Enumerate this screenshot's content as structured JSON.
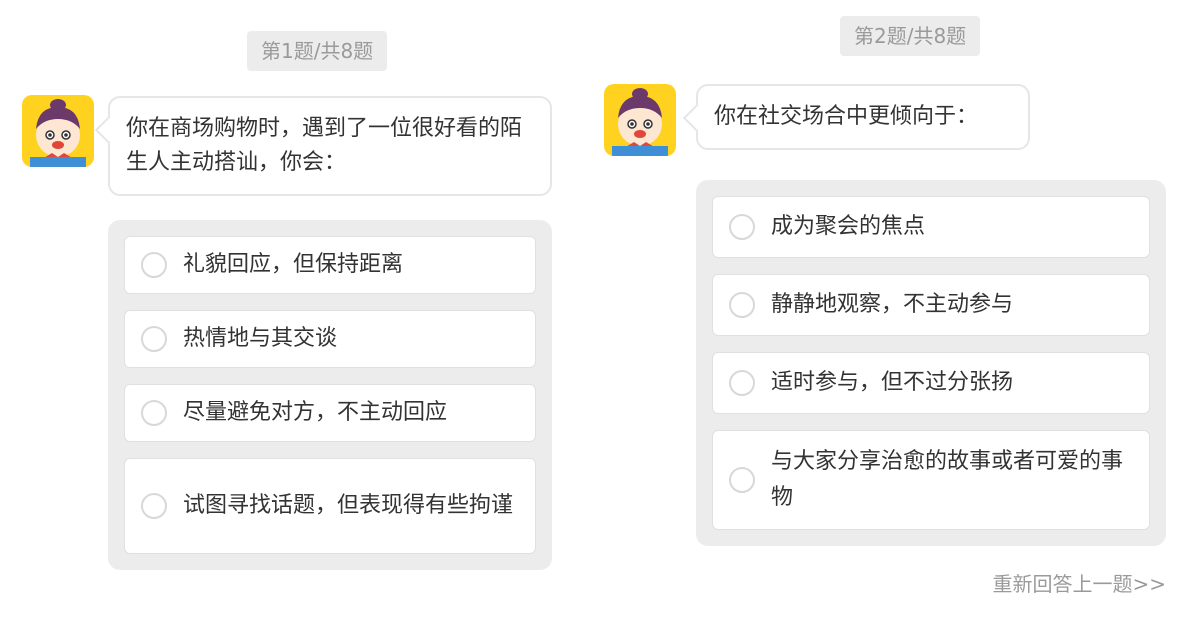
{
  "questions": [
    {
      "counter": "第1题/共8题",
      "prompt": "你在商场购物时，遇到了一位很好看的陌生人主动搭讪，你会：",
      "options": [
        "礼貌回应，但保持距离",
        "热情地与其交谈",
        "尽量避免对方，不主动回应",
        "试图寻找话题，但表现得有些拘谨"
      ]
    },
    {
      "counter": "第2题/共8题",
      "prompt": "你在社交场合中更倾向于：",
      "options": [
        "成为聚会的焦点",
        "静静地观察，不主动参与",
        "适时参与，但不过分张扬",
        "与大家分享治愈的故事或者可爱的事物"
      ]
    }
  ],
  "footer": {
    "redo_label": "重新回答上一题>>"
  },
  "colors": {
    "avatar_bg": "#ffd21f",
    "panel_bg": "#ececec",
    "muted_text": "#9a9a9a",
    "body_text": "#333333"
  },
  "icons": {
    "avatar": "cartoon-boy-avatar-icon",
    "radio": "radio-unchecked-icon"
  }
}
